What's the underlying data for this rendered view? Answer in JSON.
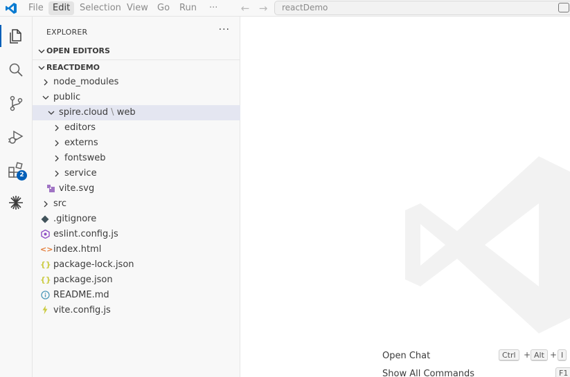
{
  "menu": [
    "File",
    "Edit",
    "Selection",
    "View",
    "Go",
    "Run",
    "···"
  ],
  "command_center": {
    "text": "reactDemo"
  },
  "activity": {
    "extensions_badge": "2"
  },
  "explorer": {
    "title": "EXPLORER",
    "more": "···",
    "sections": {
      "open_editors": "OPEN EDITORS",
      "project": "REACTDEMO"
    },
    "tree": {
      "node_modules": "node_modules",
      "public": "public",
      "spire_a": "spire.cloud",
      "spire_sep": " \\ ",
      "spire_b": "web",
      "editors": "editors",
      "externs": "externs",
      "fontsweb": "fontsweb",
      "service": "service",
      "vite_svg": "vite.svg",
      "src": "src",
      "gitignore": ".gitignore",
      "eslint": "eslint.config.js",
      "index": "index.html",
      "package_lock": "package-lock.json",
      "package": "package.json",
      "readme": "README.md",
      "vite_config": "vite.config.js"
    }
  },
  "editor": {
    "hints": {
      "open_chat": "Open Chat",
      "open_chat_keys": [
        "Ctrl",
        "+",
        "Alt",
        "+",
        "I"
      ],
      "show_all": "Show All Commands",
      "show_all_keys": [
        "F1"
      ]
    }
  },
  "colors": {
    "accent": "#005fb8",
    "selection": "#e4e6f1",
    "sidebar_bg": "#f8f8f8"
  }
}
